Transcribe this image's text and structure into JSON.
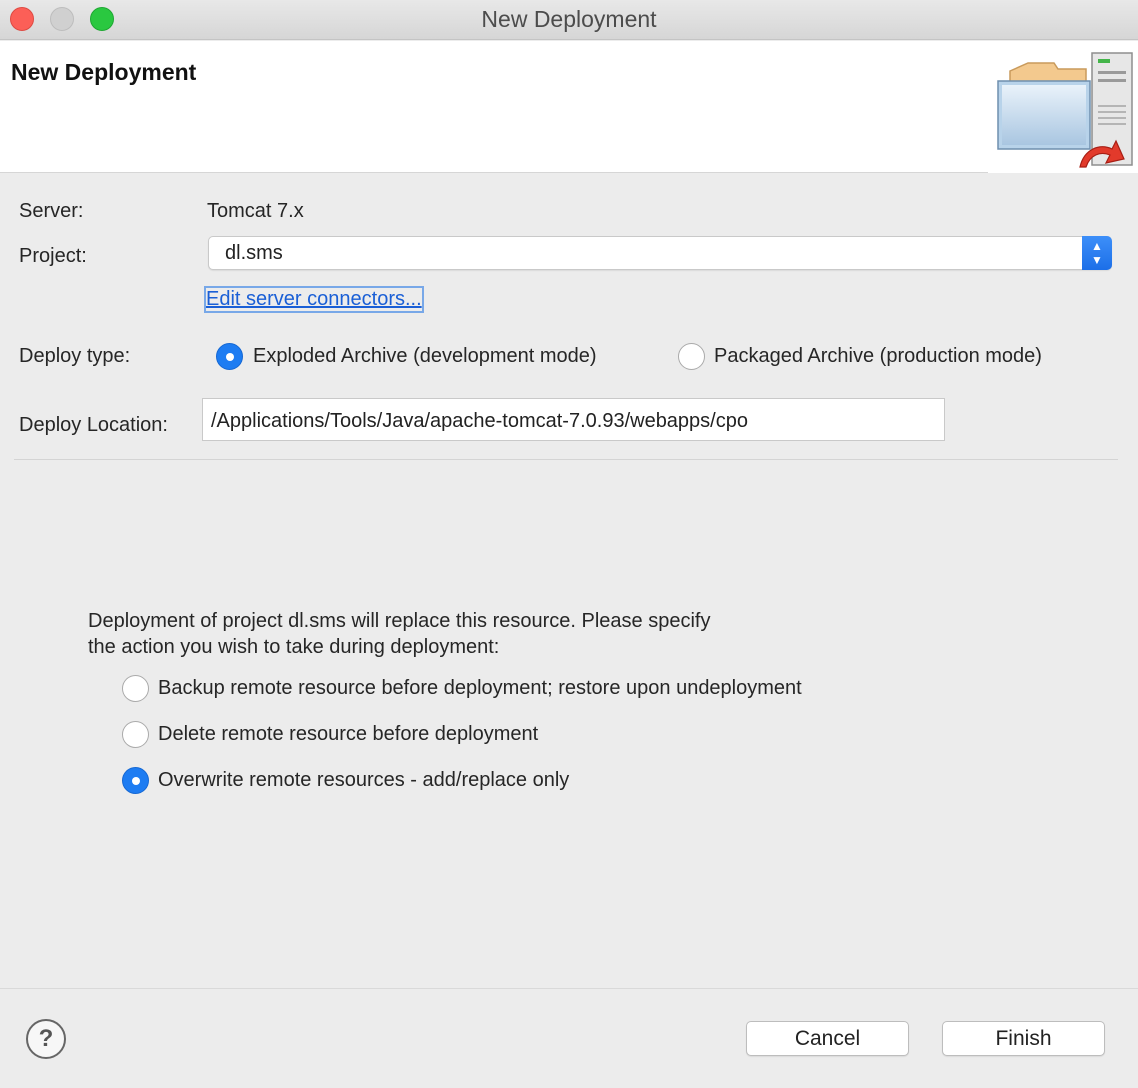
{
  "window": {
    "title": "New Deployment"
  },
  "header": {
    "title": "New Deployment",
    "icon": "deploy-wizard-icon"
  },
  "form": {
    "server_label": "Server:",
    "server_value": "Tomcat  7.x",
    "project_label": "Project:",
    "project_value": "dl.sms",
    "edit_connectors_link": "Edit server connectors...",
    "deploy_type_label": "Deploy type:",
    "deploy_type_options": [
      {
        "label": "Exploded Archive (development mode)",
        "selected": true
      },
      {
        "label": "Packaged Archive (production mode)",
        "selected": false
      }
    ],
    "deploy_location_label": "Deploy Location:",
    "deploy_location_value": "/Applications/Tools/Java/apache-tomcat-7.0.93/webapps/cpo"
  },
  "replace": {
    "description_line1": "Deployment of project dl.sms will replace this resource. Please specify",
    "description_line2": "the action you wish to take during deployment:",
    "options": [
      {
        "label": "Backup remote resource before deployment; restore upon undeployment",
        "selected": false
      },
      {
        "label": "Delete remote resource before deployment",
        "selected": false
      },
      {
        "label": "Overwrite remote resources - add/replace only",
        "selected": true
      }
    ]
  },
  "footer": {
    "help_label": "?",
    "cancel_label": "Cancel",
    "finish_label": "Finish"
  },
  "colors": {
    "accent": "#1d7cf2",
    "link": "#1a5fd6"
  }
}
